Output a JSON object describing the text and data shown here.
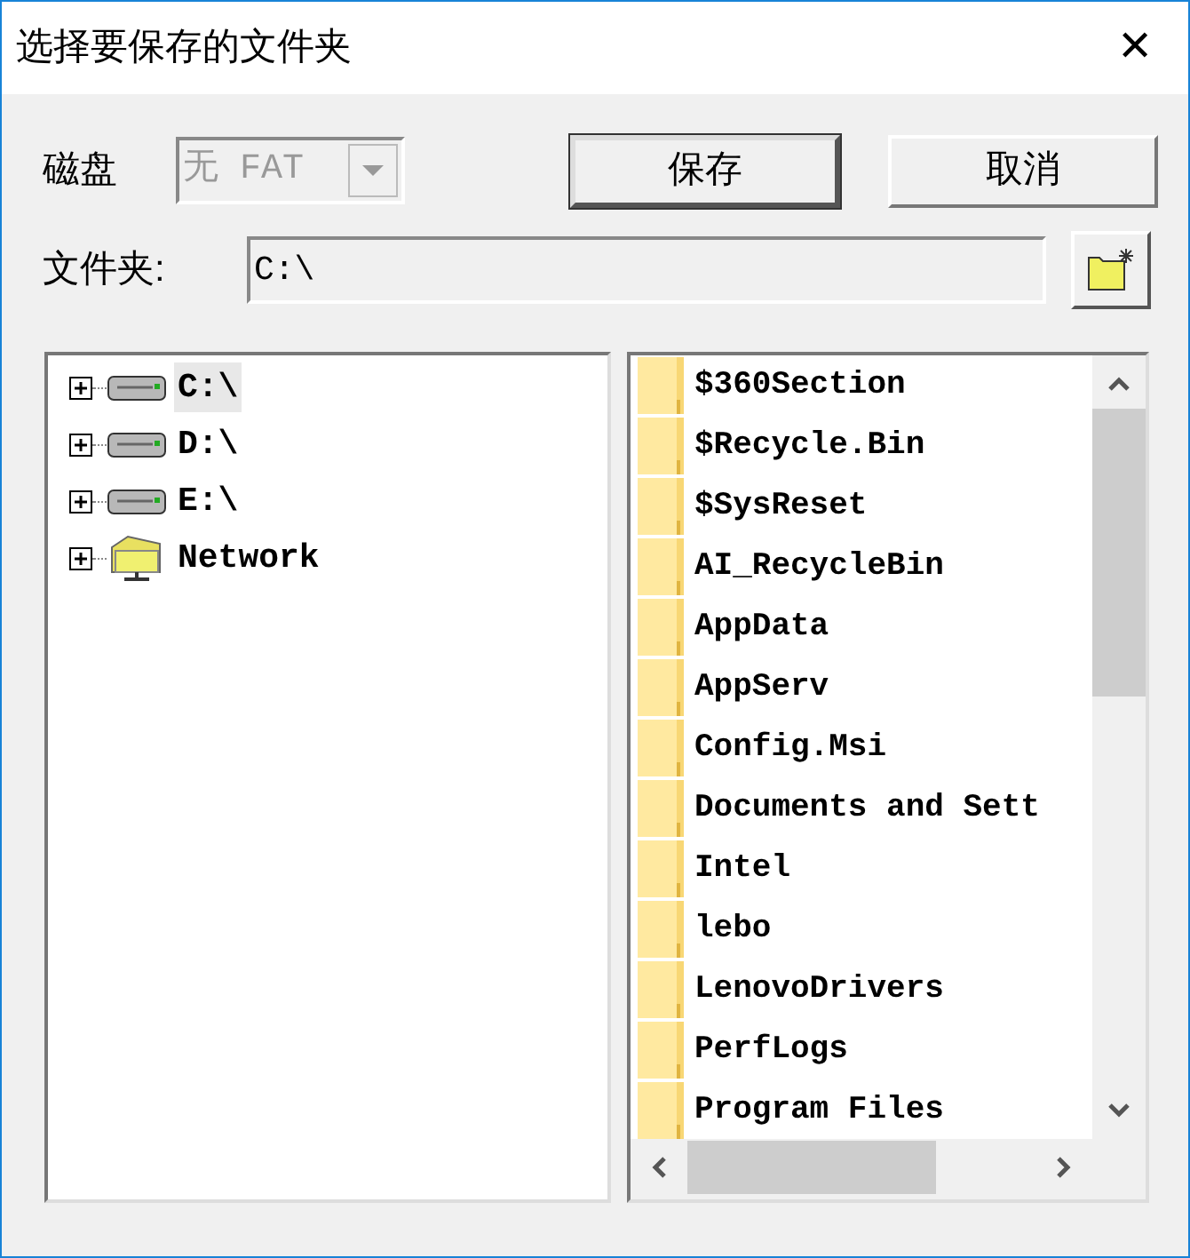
{
  "window": {
    "title": "选择要保存的文件夹",
    "close": "✕"
  },
  "disk": {
    "label": "磁盘",
    "value": "无 FAT",
    "disabled": true
  },
  "buttons": [
    {
      "label": "保存",
      "default": true
    },
    {
      "label": "取消",
      "default": false
    }
  ],
  "folder": {
    "label": "文件夹:",
    "value": "C:\\"
  },
  "tree": [
    {
      "label": "C:\\",
      "kind": "drive",
      "selected": true,
      "expanded": false
    },
    {
      "label": "D:\\",
      "kind": "drive",
      "selected": false,
      "expanded": false
    },
    {
      "label": "E:\\",
      "kind": "drive",
      "selected": false,
      "expanded": false
    },
    {
      "label": "Network",
      "kind": "network",
      "selected": false,
      "expanded": false
    }
  ],
  "folders": [
    "$360Section",
    "$Recycle.Bin",
    "$SysReset",
    "AI_RecycleBin",
    "AppData",
    "AppServ",
    "Config.Msi",
    "Documents and Sett",
    "Intel",
    "lebo",
    "LenovoDrivers",
    "PerfLogs",
    "Program Files"
  ]
}
